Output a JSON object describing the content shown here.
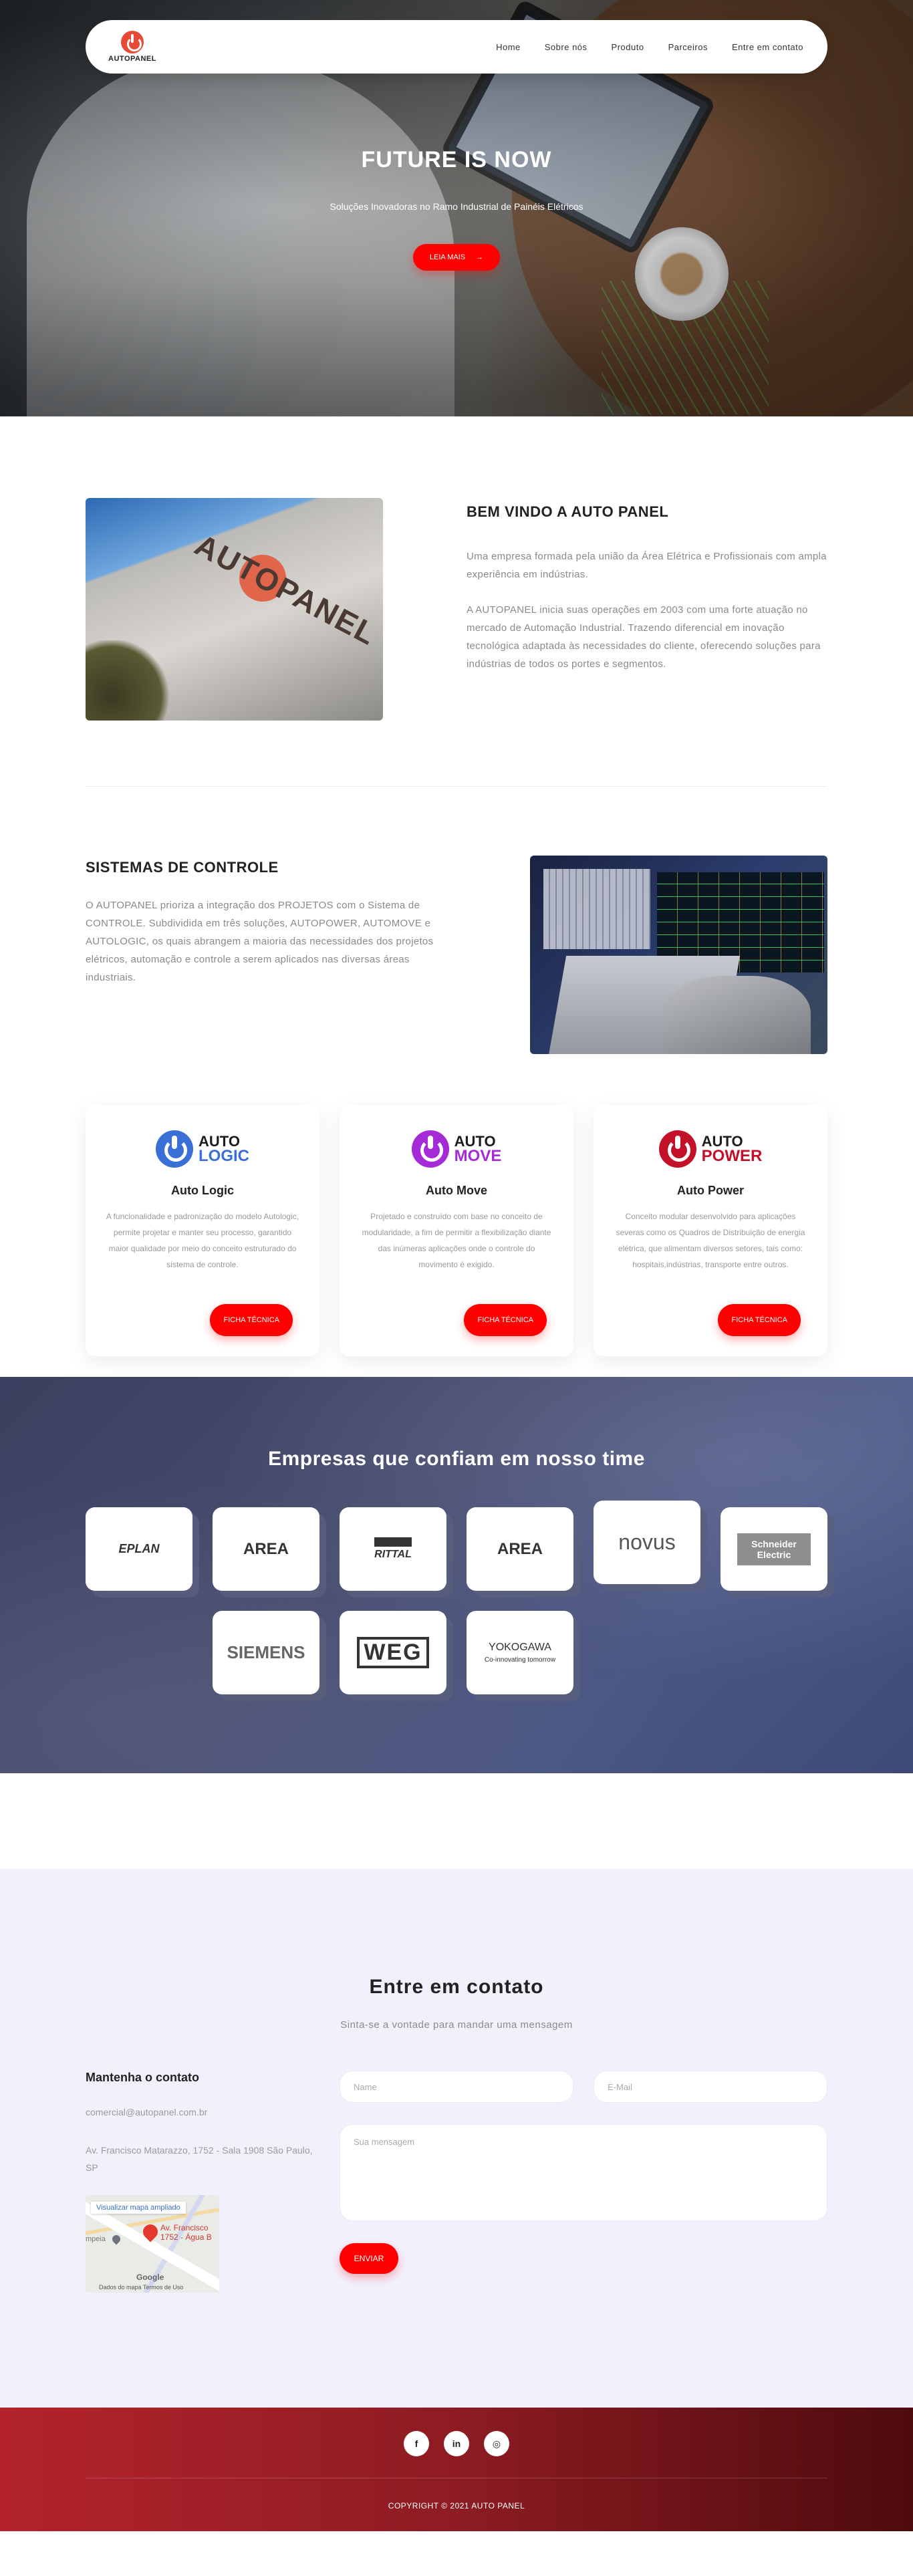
{
  "brand": {
    "logo_text": "AUTOPANEL"
  },
  "nav": {
    "items": [
      "Home",
      "Sobre nós",
      "Produto",
      "Parceiros",
      "Entre em contato"
    ]
  },
  "hero": {
    "title": "FUTURE IS NOW",
    "subtitle": "Soluções Inovadoras no Ramo Industrial de Painéis Elétricos",
    "button": "LEIA MAIS",
    "button_arrow": "→"
  },
  "about": {
    "sign_text": "AUTOPANEL",
    "title": "BEM VINDO A AUTO PANEL",
    "p1": "Uma empresa formada pela união da Área Elétrica e Profissionais com ampla experiência em indústrias.",
    "p2": "A AUTOPANEL inicia suas operações em 2003 com uma forte atuação no mercado de Automação Industrial. Trazendo diferencial em inovação tecnológica adaptada às necessidades do cliente, oferecendo soluções para indústrias de todos os portes e segmentos."
  },
  "systems": {
    "title": "SISTEMAS DE CONTROLE",
    "text": "O AUTOPANEL prioriza a integração dos PROJETOS com o Sistema de CONTROLE. Subdividida em três soluções, AUTOPOWER, AUTOMOVE e AUTOLOGIC, os quais abrangem a maioria das necessidades dos projetos elétricos, automação e controle a serem aplicados nas diversas áreas industriais.",
    "cards": [
      {
        "word1": "AUTO",
        "word2": "LOGIC",
        "color": "#3b6fd8",
        "title": "Auto Logic",
        "desc": "A funcionalidade e padronização do modelo Autologic, permite projetar e manter seu processo, garantido maior qualidade por meio do conceito estruturado do sistema de controle.",
        "button": "FICHA TÉCNICA"
      },
      {
        "word1": "AUTO",
        "word2": "MOVE",
        "color": "#a52bd6",
        "title": "Auto Move",
        "desc": "Projetado e construído com base no conceito de modularidade, a fim de permitir a flexibilização diante das inúmeras aplicações onde o controle do movimento é exigido.",
        "button": "FICHA TÉCNICA"
      },
      {
        "word1": "AUTO",
        "word2": "POWER",
        "color": "#c3112a",
        "title": "Auto Power",
        "desc": "Conceito modular desenvolvido para aplicações severas como os Quadros de Distribuição de energia elétrica, que alimentam diversos setores, tais como: hospitais,indústrias, transporte entre outros.",
        "button": "FICHA TÉCNICA"
      }
    ]
  },
  "clients": {
    "title": "Empresas que confiam em nosso time",
    "logos": [
      "EPLAN",
      "AREA",
      "RITTAL",
      "AREA",
      "novus",
      "Schneider Electric",
      "SIEMENS",
      "WEG",
      "YOKOGAWA"
    ],
    "logos_sub": [
      "",
      "",
      "",
      "",
      "",
      "",
      "",
      "",
      "Co-innovating tomorrow"
    ]
  },
  "contact": {
    "title": "Entre em contato",
    "subtitle": "Sinta-se a vontade para mandar uma mensagem",
    "info_title": "Mantenha o contato",
    "email": "comercial@autopanel.com.br",
    "address": "Av. Francisco Matarazzo, 1752 - Sala 1908 São Paulo, SP",
    "map": {
      "link": "Visualizar mapa ampliado",
      "pin_label": "Av. Francisco 1752 - Água B",
      "google": "Google",
      "footer": "Dados do mapa   Termos de Uso",
      "side_word": "mpeia"
    },
    "name_placeholder": "Name",
    "email_placeholder": "E-Mail",
    "message_placeholder": "Sua mensagem",
    "send": "ENVIAR"
  },
  "footer": {
    "socials": [
      "facebook-icon",
      "linkedin-icon",
      "instagram-icon"
    ],
    "social_glyphs": [
      "f",
      "in",
      "◎"
    ],
    "copyright": "COPYRIGHT © 2021 AUTO PANEL"
  }
}
